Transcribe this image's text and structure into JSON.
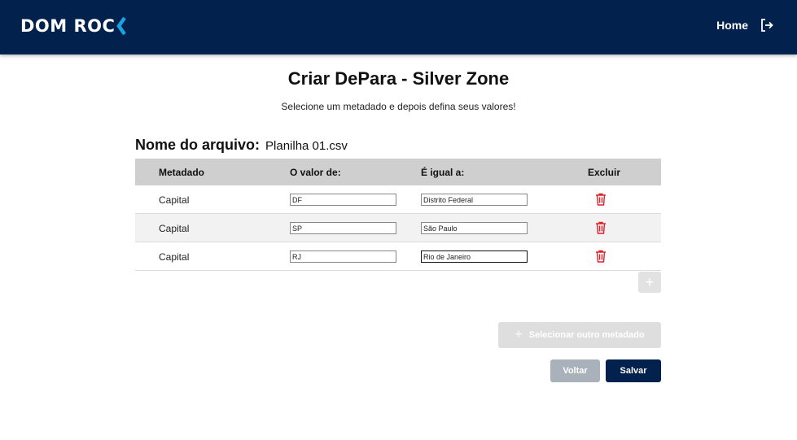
{
  "header": {
    "logo_text": "DOM ROC",
    "logo_mark": "K",
    "home_label": "Home",
    "logout_icon": "logout-icon",
    "background_color": "#02214d",
    "accent_color": "#19a3e0"
  },
  "page": {
    "title": "Criar DePara - Silver Zone",
    "subtitle": "Selecione um metadado e depois defina seus valores!"
  },
  "file": {
    "label": "Nome do arquivo:",
    "name": "Planilha 01.csv"
  },
  "table": {
    "columns": [
      "Metadado",
      "O valor de:",
      "É igual a:",
      "Excluir"
    ],
    "rows": [
      {
        "metadado": "Capital",
        "valor_de": "DF",
        "igual_a": "Distrito Federal"
      },
      {
        "metadado": "Capital",
        "valor_de": "SP",
        "igual_a": "São Paulo"
      },
      {
        "metadado": "Capital",
        "valor_de": "RJ",
        "igual_a": "Rio de Janeiro"
      }
    ],
    "delete_icon": "trash-icon",
    "delete_color": "#e0202a"
  },
  "actions": {
    "add_row_symbol": "+",
    "select_other_label": "Selecionar outro metadado",
    "select_other_icon": "+",
    "back_label": "Voltar",
    "save_label": "Salvar"
  }
}
